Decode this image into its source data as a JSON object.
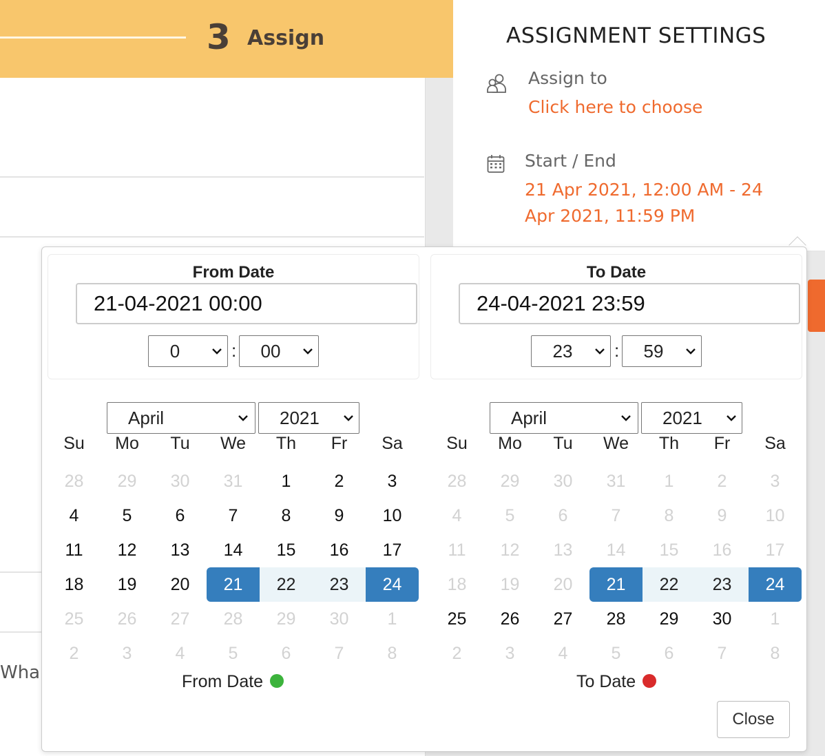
{
  "header": {
    "step_number": "3",
    "step_label": "Assign"
  },
  "background": {
    "partial_text": "Wha"
  },
  "settings": {
    "title": "ASSIGNMENT SETTINGS",
    "assign_to_label": "Assign to",
    "assign_to_link": "Click here to choose",
    "start_end_label": "Start / End",
    "start_end_line1": "21 Apr 2021, 12:00 AM - 24",
    "start_end_line2": "Apr 2021, 11:59 PM",
    "icons": [
      "users-icon",
      "calendar-icon"
    ]
  },
  "picker": {
    "weekdays": [
      "Su",
      "Mo",
      "Tu",
      "We",
      "Th",
      "Fr",
      "Sa"
    ],
    "close_label": "Close",
    "colors": {
      "active": "#357ebd",
      "in_range": "#ebf4f8",
      "accent": "#ef6a2e",
      "from_dot": "#3cb33c",
      "to_dot": "#d92b2b"
    },
    "from": {
      "title": "From Date",
      "value": "21-04-2021 00:00",
      "hour": "0",
      "minute": "00",
      "month": "April",
      "year": "2021",
      "legend": "From Date",
      "weeks": [
        [
          "28",
          "29",
          "30",
          "31",
          "1",
          "2",
          "3"
        ],
        [
          "4",
          "5",
          "6",
          "7",
          "8",
          "9",
          "10"
        ],
        [
          "11",
          "12",
          "13",
          "14",
          "15",
          "16",
          "17"
        ],
        [
          "18",
          "19",
          "20",
          "21",
          "22",
          "23",
          "24"
        ],
        [
          "25",
          "26",
          "27",
          "28",
          "29",
          "30",
          "1"
        ],
        [
          "2",
          "3",
          "4",
          "5",
          "6",
          "7",
          "8"
        ]
      ],
      "states": [
        [
          "off",
          "off",
          "off",
          "off",
          "",
          "",
          ""
        ],
        [
          "",
          "",
          "",
          "",
          "",
          "",
          ""
        ],
        [
          "",
          "",
          "",
          "",
          "",
          "",
          ""
        ],
        [
          "",
          "",
          "",
          "start",
          "range",
          "range",
          "end"
        ],
        [
          "off",
          "off",
          "off",
          "off",
          "off",
          "off",
          "off"
        ],
        [
          "off",
          "off",
          "off",
          "off",
          "off",
          "off",
          "off"
        ]
      ]
    },
    "to": {
      "title": "To Date",
      "value": "24-04-2021 23:59",
      "hour": "23",
      "minute": "59",
      "month": "April",
      "year": "2021",
      "legend": "To Date",
      "weeks": [
        [
          "28",
          "29",
          "30",
          "31",
          "1",
          "2",
          "3"
        ],
        [
          "4",
          "5",
          "6",
          "7",
          "8",
          "9",
          "10"
        ],
        [
          "11",
          "12",
          "13",
          "14",
          "15",
          "16",
          "17"
        ],
        [
          "18",
          "19",
          "20",
          "21",
          "22",
          "23",
          "24"
        ],
        [
          "25",
          "26",
          "27",
          "28",
          "29",
          "30",
          "1"
        ],
        [
          "2",
          "3",
          "4",
          "5",
          "6",
          "7",
          "8"
        ]
      ],
      "states": [
        [
          "off",
          "off",
          "off",
          "off",
          "off",
          "off",
          "off"
        ],
        [
          "off",
          "off",
          "off",
          "off",
          "off",
          "off",
          "off"
        ],
        [
          "off",
          "off",
          "off",
          "off",
          "off",
          "off",
          "off"
        ],
        [
          "off",
          "off",
          "off",
          "start",
          "range",
          "range",
          "end"
        ],
        [
          "",
          "",
          "",
          "",
          "",
          "",
          "off"
        ],
        [
          "off",
          "off",
          "off",
          "off",
          "off",
          "off",
          "off"
        ]
      ]
    }
  }
}
